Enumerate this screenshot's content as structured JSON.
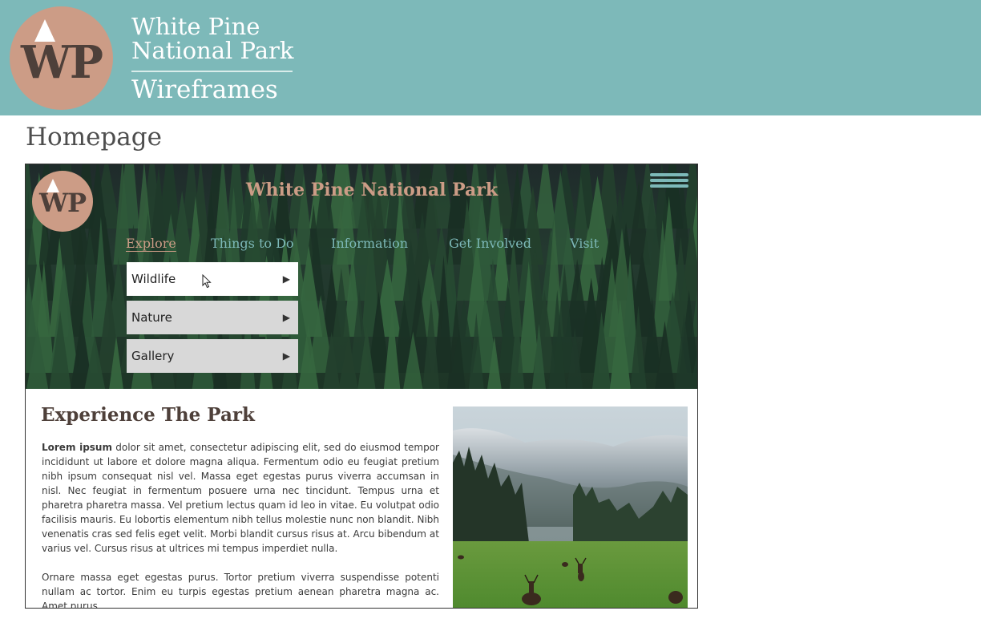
{
  "banner": {
    "logo_text": "WP",
    "title_line1": "White Pine",
    "title_line2": "National Park",
    "subtitle": "Wireframes"
  },
  "page_heading": "Homepage",
  "wireframe": {
    "logo_text": "WP",
    "site_title": "White Pine  National Park",
    "menu_icon": "hamburger-menu-icon",
    "nav": [
      {
        "label": "Explore",
        "active": true
      },
      {
        "label": "Things to Do"
      },
      {
        "label": "Information"
      },
      {
        "label": "Get Involved"
      },
      {
        "label": "Visit"
      }
    ],
    "dropdown": [
      {
        "label": "Wildlife",
        "arrow": "▶",
        "hovered": true
      },
      {
        "label": "Nature",
        "arrow": "▶"
      },
      {
        "label": "Gallery",
        "arrow": "▶"
      }
    ],
    "content": {
      "title": "Experience The Park",
      "p1_bold": "Lorem ipsum",
      "p1_rest": " dolor sit amet, consectetur adipiscing elit, sed do eiusmod tempor incididunt ut labore et dolore magna aliqua. Fermentum odio eu feugiat pretium nibh ipsum consequat nisl vel. Massa eget egestas purus viverra accumsan in nisl. Nec feugiat in fermentum posuere urna nec tincidunt. Tempus urna et pharetra pharetra massa. Vel pretium lectus quam id leo in vitae. Eu volutpat odio facilisis mauris. Eu lobortis elementum nibh tellus molestie nunc non blandit. Nibh venenatis cras sed felis eget velit. Morbi blandit cursus risus at. Arcu bibendum at varius vel. Cursus risus at ultrices mi tempus imperdiet nulla.",
      "p2": "Ornare massa eget egestas purus. Tortor pretium viverra suspendisse potenti nullam ac tortor. Enim eu turpis egestas pretium aenean pharetra magna ac. Amet purus"
    }
  },
  "colors": {
    "banner_teal": "#7db9b9",
    "logo_pink": "#cc9c86",
    "logo_text": "#4e403a"
  }
}
